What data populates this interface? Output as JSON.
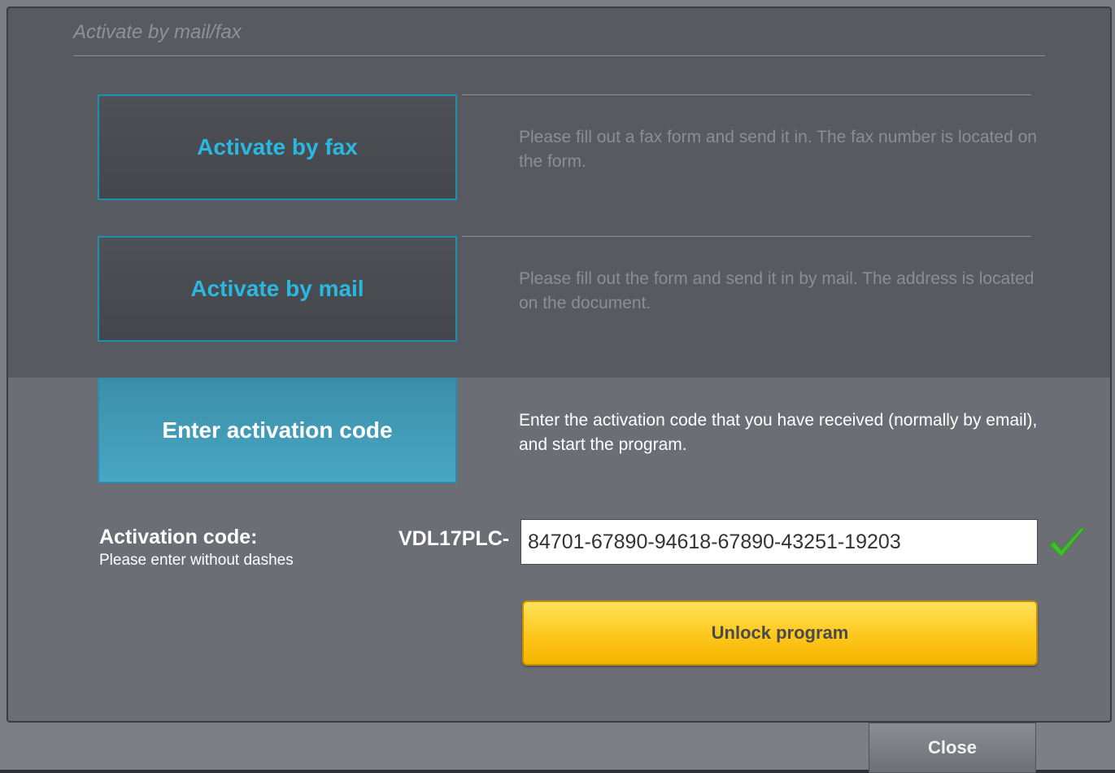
{
  "header": {
    "title": "Activate by mail/fax"
  },
  "options": [
    {
      "label": "Activate by fax",
      "description": "Please fill out a fax form and send it in. The fax number is located on the form."
    },
    {
      "label": "Activate by mail",
      "description": "Please fill out the form and send it in by mail. The address is located on the document."
    },
    {
      "label": "Enter activation code",
      "description": "Enter the activation code that you have received (normally by email), and start the program."
    }
  ],
  "activation": {
    "label": "Activation code:",
    "hint": "Please enter without dashes",
    "prefix": "VDL17PLC-",
    "value": "84701-67890-94618-67890-43251-19203",
    "valid_icon": "checkmark-icon",
    "valid_color": "#3fbf2a"
  },
  "buttons": {
    "unlock": "Unlock program",
    "close": "Close"
  },
  "colors": {
    "accent": "#2bb8e0",
    "active_option": "#48a7c4",
    "unlock_button": "#fdc71c"
  }
}
